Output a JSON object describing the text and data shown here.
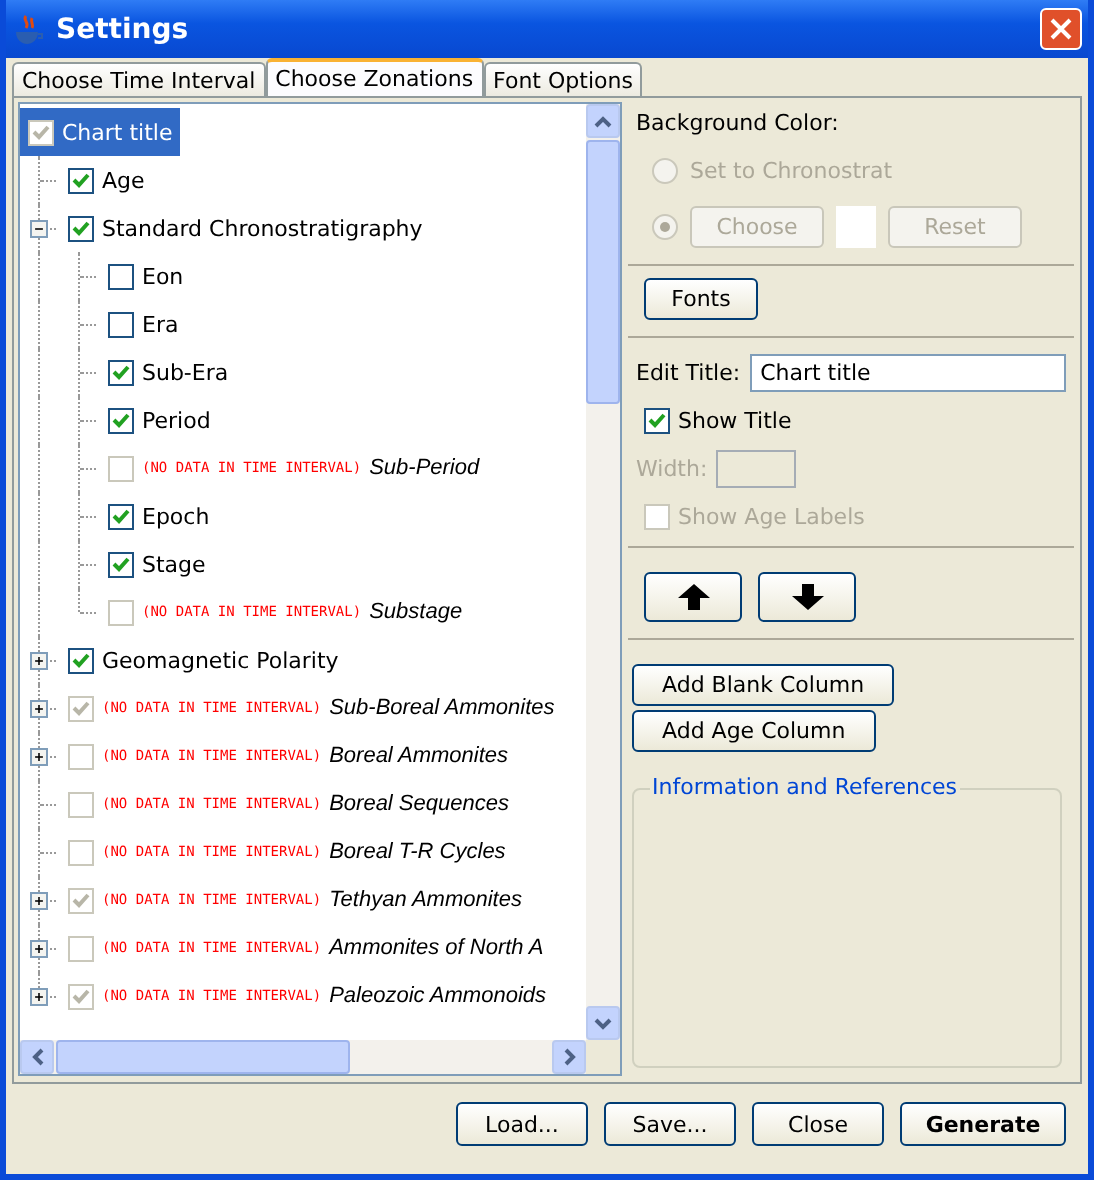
{
  "window": {
    "title": "Settings"
  },
  "tabs": [
    {
      "label": "Choose Time Interval",
      "selected": false
    },
    {
      "label": "Choose Zonations",
      "selected": true
    },
    {
      "label": "Font Options",
      "selected": false
    }
  ],
  "tree": {
    "label": "Chart title",
    "checked": true,
    "disabled": true,
    "selected": true,
    "children": [
      {
        "label": "Age",
        "checked": true,
        "disabled": false
      },
      {
        "label": "Standard Chronostratigraphy",
        "checked": true,
        "disabled": false,
        "expanded": true,
        "children": [
          {
            "label": "Eon",
            "checked": false,
            "disabled": false
          },
          {
            "label": "Era",
            "checked": false,
            "disabled": false
          },
          {
            "label": "Sub-Era",
            "checked": true,
            "disabled": false
          },
          {
            "label": "Period",
            "checked": true,
            "disabled": false
          },
          {
            "label": "Sub-Period",
            "note": "(NO DATA IN TIME INTERVAL)",
            "checked": false,
            "disabled": true
          },
          {
            "label": "Epoch",
            "checked": true,
            "disabled": false
          },
          {
            "label": "Stage",
            "checked": true,
            "disabled": false
          },
          {
            "label": "Substage",
            "note": "(NO DATA IN TIME INTERVAL)",
            "checked": false,
            "disabled": true
          }
        ]
      },
      {
        "label": "Geomagnetic Polarity",
        "checked": true,
        "disabled": false,
        "expanded": false
      },
      {
        "label": "Sub-Boreal Ammonites",
        "note": "(NO DATA IN TIME INTERVAL)",
        "checked": true,
        "disabled": true,
        "expanded": false
      },
      {
        "label": "Boreal Ammonites",
        "note": "(NO DATA IN TIME INTERVAL)",
        "checked": false,
        "disabled": true,
        "expanded": false
      },
      {
        "label": "Boreal Sequences",
        "note": "(NO DATA IN TIME INTERVAL)",
        "checked": false,
        "disabled": true
      },
      {
        "label": "Boreal T-R Cycles",
        "note": "(NO DATA IN TIME INTERVAL)",
        "checked": false,
        "disabled": true
      },
      {
        "label": "Tethyan Ammonites",
        "note": "(NO DATA IN TIME INTERVAL)",
        "checked": true,
        "disabled": true,
        "expanded": false
      },
      {
        "label": "Ammonites of North A",
        "note": "(NO DATA IN TIME INTERVAL)",
        "checked": false,
        "disabled": true,
        "expanded": false
      },
      {
        "label": "Paleozoic Ammonoids",
        "note": "(NO DATA IN TIME INTERVAL)",
        "checked": true,
        "disabled": true,
        "expanded": false
      }
    ]
  },
  "background_color": {
    "heading": "Background Color:",
    "disabled": true,
    "options": [
      {
        "kind": "preset",
        "label": "Set to Chronostrat",
        "selected": false
      },
      {
        "kind": "custom",
        "selected": true
      }
    ],
    "buttons": [
      "Choose",
      "Reset"
    ]
  },
  "fonts_button": "Fonts",
  "edit_title": {
    "label": "Edit Title:",
    "value": "Chart title"
  },
  "show_title": {
    "label": "Show Title",
    "checked": true,
    "disabled": false
  },
  "width": {
    "label": "Width:",
    "disabled": true
  },
  "show_age_labels": {
    "label": "Show Age Labels",
    "checked": false,
    "disabled": true
  },
  "move_buttons": [
    {
      "kind": "up"
    },
    {
      "kind": "down"
    }
  ],
  "add_buttons": [
    "Add Blank Column",
    "Add Age Column"
  ],
  "info": {
    "title": "Information and References"
  },
  "footer_buttons": [
    {
      "label": "Load...",
      "kind": "normal"
    },
    {
      "label": "Save...",
      "kind": "normal"
    },
    {
      "label": "Close",
      "kind": "normal"
    },
    {
      "label": "Generate",
      "kind": "default"
    }
  ]
}
